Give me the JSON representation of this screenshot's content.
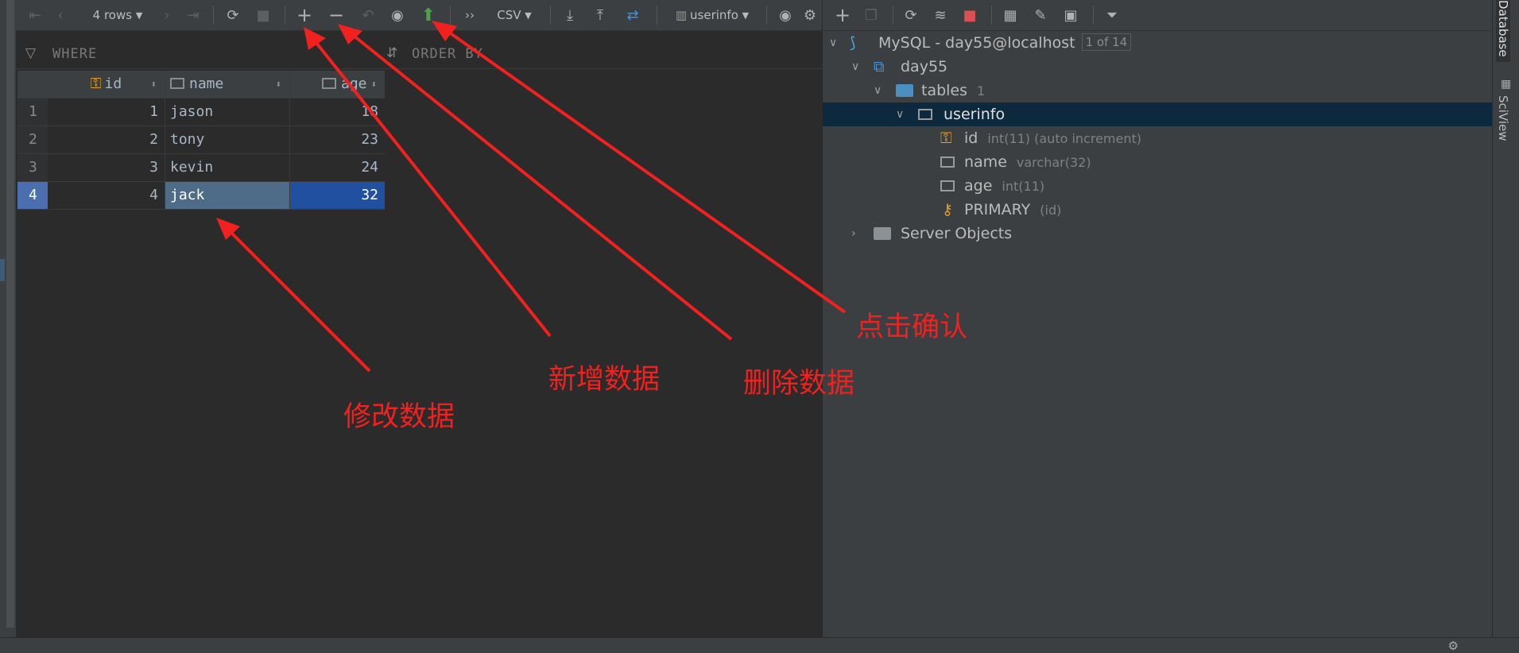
{
  "editor_toolbar": {
    "rows_label": "4 rows",
    "format_label": "CSV",
    "table_selector": "userinfo",
    "icons": [
      "first-page-icon",
      "prev-page-icon",
      "next-page-icon",
      "last-page-icon",
      "reload-icon",
      "stop-icon",
      "add-row-icon",
      "delete-row-icon",
      "revert-icon",
      "preview-changes-icon",
      "submit-icon",
      "more-icon",
      "export-icon",
      "import-icon",
      "compare-icon",
      "view-icon",
      "settings-icon"
    ]
  },
  "filter": {
    "where_label": "WHERE",
    "order_by_label": "ORDER BY"
  },
  "grid": {
    "columns": [
      "id",
      "name",
      "age"
    ],
    "rows": [
      {
        "num": "1",
        "id": "1",
        "name": "jason",
        "age": "18"
      },
      {
        "num": "2",
        "id": "2",
        "name": "tony",
        "age": "23"
      },
      {
        "num": "3",
        "id": "3",
        "name": "kevin",
        "age": "24"
      },
      {
        "num": "4",
        "id": "4",
        "name": "jack",
        "age": "32"
      }
    ]
  },
  "tree": {
    "connection": "MySQL - day55@localhost",
    "connection_badge": "1 of 14",
    "schema": "day55",
    "tables_label": "tables",
    "tables_count": "1",
    "table": "userinfo",
    "columns": [
      {
        "name": "id",
        "type": "int(11) (auto increment)"
      },
      {
        "name": "name",
        "type": "varchar(32)"
      },
      {
        "name": "age",
        "type": "int(11)"
      }
    ],
    "index": {
      "name": "PRIMARY",
      "cols": "(id)"
    },
    "server_objects": "Server Objects"
  },
  "side_tabs": {
    "database": "Database",
    "sciview": "SciView"
  },
  "annotations": {
    "modify": "修改数据",
    "add": "新增数据",
    "delete": "删除数据",
    "confirm": "点击确认"
  },
  "colors": {
    "arrow": "#f0211e",
    "selection": "#2150a0",
    "tree_selection": "#0d293e",
    "submit_green": "#4ea04f"
  }
}
